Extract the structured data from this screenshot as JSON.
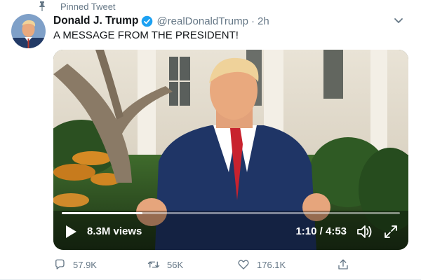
{
  "pinned": {
    "label": "Pinned Tweet"
  },
  "tweet": {
    "author_name": "Donald J. Trump",
    "handle": "@realDonaldTrump",
    "separator": "·",
    "time": "2h",
    "text": "A MESSAGE FROM THE PRESIDENT!"
  },
  "video": {
    "views": "8.3M views",
    "time_display": "1:10 / 4:53",
    "progress_fraction": 0.238
  },
  "actions": {
    "reply_count": "57.9K",
    "retweet_count": "56K",
    "like_count": "176.1K"
  },
  "icons": {
    "pin": "pin-icon",
    "verified": "verified-badge-icon",
    "caret": "chevron-down-icon",
    "play": "play-icon",
    "volume": "volume-icon",
    "fullscreen": "fullscreen-icon",
    "reply": "reply-icon",
    "retweet": "retweet-icon",
    "like": "heart-icon",
    "share": "share-icon"
  },
  "colors": {
    "brand_blue": "#1da1f2",
    "secondary_text": "#657786",
    "primary_text": "#14171a"
  }
}
